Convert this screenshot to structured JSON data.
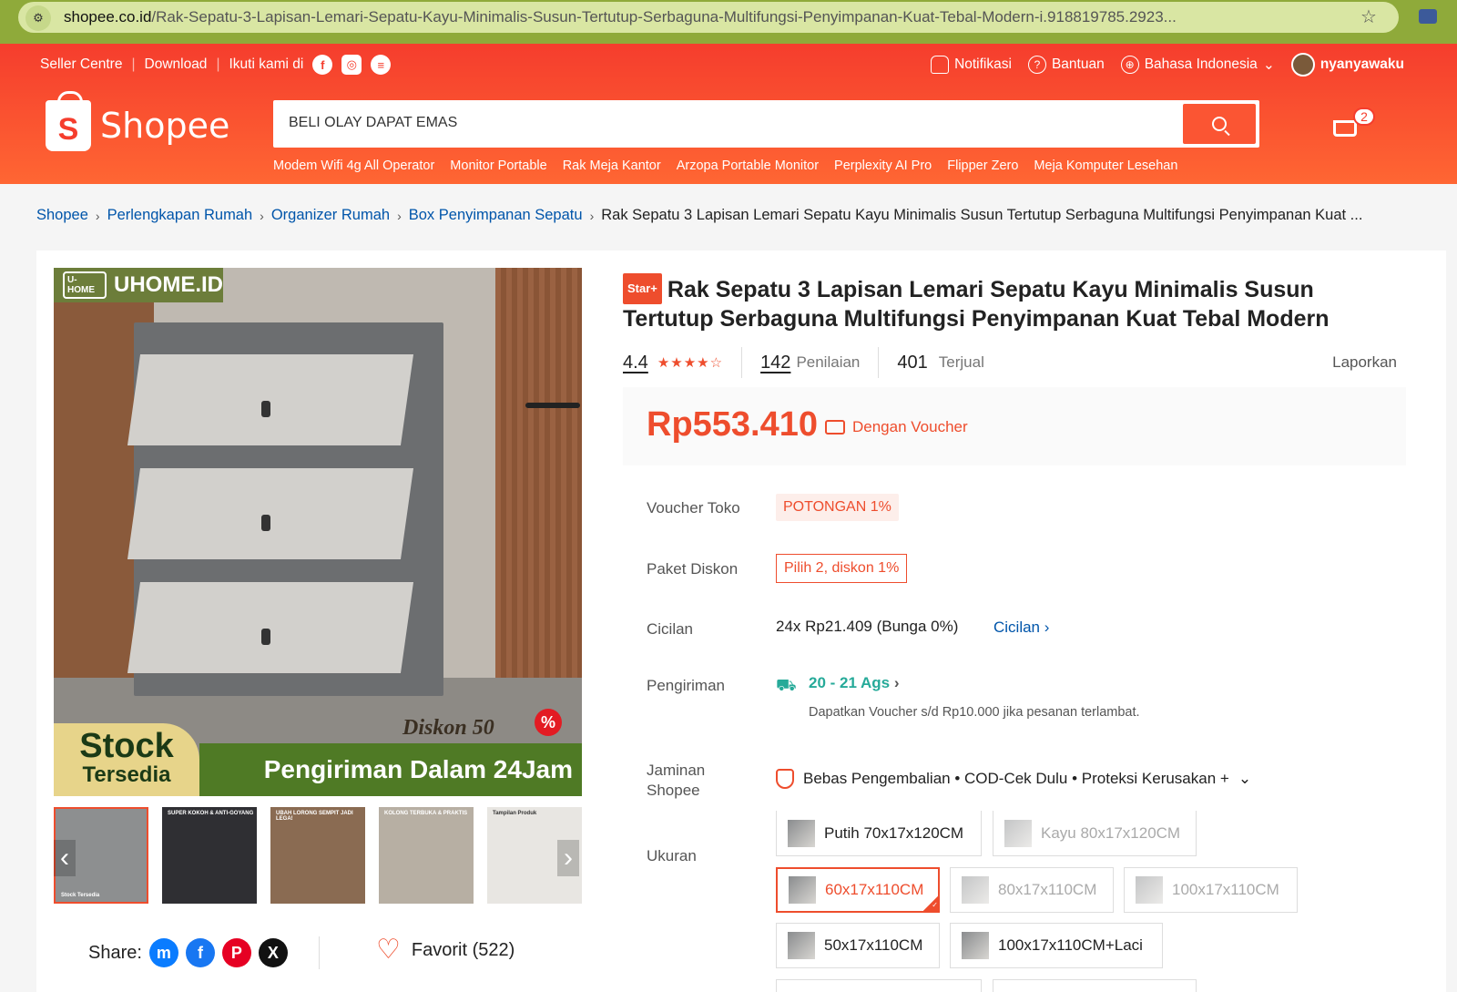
{
  "browser": {
    "url_domain": "shopee.co.id",
    "url_path": "/Rak-Sepatu-3-Lapisan-Lemari-Sepatu-Kayu-Minimalis-Susun-Tertutup-Serbaguna-Multifungsi-Penyimpanan-Kuat-Tebal-Modern-i.918819785.2923..."
  },
  "topnav": {
    "seller_centre": "Seller Centre",
    "download": "Download",
    "follow": "Ikuti kami di",
    "notifications": "Notifikasi",
    "help": "Bantuan",
    "language": "Bahasa Indonesia",
    "username": "nyanyawaku"
  },
  "header": {
    "logo_text": "Shopee",
    "search_placeholder": "BELI OLAY DAPAT EMAS",
    "cart_count": "2",
    "suggestions": [
      "Modem Wifi 4g All Operator",
      "Monitor Portable",
      "Rak Meja Kantor",
      "Arzopa Portable Monitor",
      "Perplexity AI Pro",
      "Flipper Zero",
      "Meja Komputer Lesehan"
    ]
  },
  "breadcrumb": {
    "items": [
      "Shopee",
      "Perlengkapan Rumah",
      "Organizer Rumah",
      "Box Penyimpanan Sepatu"
    ],
    "current": "Rak Sepatu 3 Lapisan Lemari Sepatu Kayu Minimalis Susun Tertutup Serbaguna Multifungsi Penyimpanan Kuat ..."
  },
  "gallery": {
    "brand": "UHOME.ID",
    "brand_small": "U-HOME",
    "stock_line1": "Stock",
    "stock_line2": "Tersedia",
    "shipping_banner": "Pengiriman Dalam 24Jam",
    "discount": "Diskon 50",
    "percent": "%",
    "thumb_captions": [
      "Stock Tersedia",
      "SUPER KOKOH & ANTI-GOYANG",
      "UBAH LORONG SEMPIT JADI LEGA!",
      "KOLONG TERBUKA & PRAKTIS",
      "Tampilan Produk"
    ]
  },
  "share": {
    "label": "Share:",
    "favorite": "Favorit (522)"
  },
  "product": {
    "badge": "Star+",
    "title": "Rak Sepatu 3 Lapisan Lemari Sepatu Kayu Minimalis Susun Tertutup Serbaguna Multifungsi Penyimpanan Kuat Tebal Modern",
    "rating": "4.4",
    "rating_value": 4.4,
    "ratings_count": "142",
    "ratings_label": "Penilaian",
    "sold_count": "401",
    "sold_label": "Terjual",
    "report": "Laporkan",
    "price": "Rp553.410",
    "voucher_note": "Dengan Voucher"
  },
  "details": {
    "voucher_label": "Voucher Toko",
    "voucher_chip": "POTONGAN 1%",
    "bundle_label": "Paket Diskon",
    "bundle_chip": "Pilih 2, diskon 1%",
    "installment_label": "Cicilan",
    "installment_value": "24x Rp21.409 (Bunga 0%)",
    "installment_link": "Cicilan",
    "shipping_label": "Pengiriman",
    "shipping_value": "20 - 21 Ags",
    "shipping_note": "Dapatkan Voucher s/d Rp10.000 jika pesanan terlambat.",
    "guarantee_label_1": "Jaminan",
    "guarantee_label_2": "Shopee",
    "guarantee_value": "Bebas Pengembalian • COD-Cek Dulu • Proteksi Kerusakan +",
    "size_label": "Ukuran"
  },
  "variants": [
    {
      "label": "Putih 70x17x120CM",
      "state": "normal"
    },
    {
      "label": "Kayu 80x17x120CM",
      "state": "disabled"
    },
    {
      "label": "60x17x110CM",
      "state": "selected"
    },
    {
      "label": "80x17x110CM",
      "state": "disabled"
    },
    {
      "label": "100x17x110CM",
      "state": "disabled"
    },
    {
      "label": "50x17x110CM",
      "state": "normal"
    },
    {
      "label": "100x17x110CM+Laci",
      "state": "normal"
    }
  ],
  "colors": {
    "brand": "#ee4d2d",
    "link": "#0055aa",
    "shipping": "#26aa99"
  }
}
